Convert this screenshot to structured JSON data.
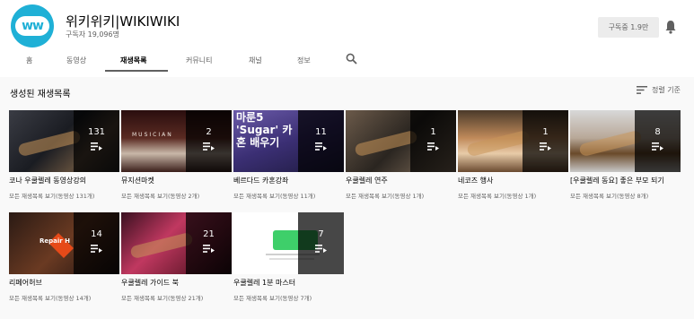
{
  "channel": {
    "name": "위키위키|WIKIWIKI",
    "subscribers": "구독자 19,096명",
    "avatar_text": "ww",
    "subscribe_label": "구독중  1.9만"
  },
  "tabs": [
    {
      "label": "홈"
    },
    {
      "label": "동영상"
    },
    {
      "label": "재생목록",
      "active": true
    },
    {
      "label": "커뮤니티"
    },
    {
      "label": "채널"
    },
    {
      "label": "정보"
    }
  ],
  "section": {
    "title": "생성된 재생목록",
    "sort_label": "정렬 기준"
  },
  "playlists": [
    {
      "title": "코나 우쿨렐레 동영상강의",
      "count": "131",
      "link": "모든 재생목록 보기(동영상 131개)"
    },
    {
      "title": "뮤지션마켓",
      "count": "2",
      "link": "모든 재생목록 보기(동영상 2개)",
      "art_text": "MUSICIAN"
    },
    {
      "title": "베르다드 카혼강좌",
      "count": "11",
      "link": "모든 재생목록 보기(동영상 11개)",
      "art_text": "마룬5 'Sugar' 카혼 배우기"
    },
    {
      "title": "우쿨렐레 연주",
      "count": "1",
      "link": "모든 재생목록 보기(동영상 1개)"
    },
    {
      "title": "네코즈 행사",
      "count": "1",
      "link": "모든 재생목록 보기(동영상 1개)"
    },
    {
      "title": "[우쿨렐레 동요] 좋은 부모 되기",
      "count": "8",
      "link": "모든 재생목록 보기(동영상 8개)"
    },
    {
      "title": "리페어허브",
      "count": "14",
      "link": "모든 재생목록 보기(동영상 14개)",
      "art_text": "Repair H"
    },
    {
      "title": "우쿨렐레 가이드 북",
      "count": "21",
      "link": "모든 재생목록 보기(동영상 21개)"
    },
    {
      "title": "우쿨렐레 1분 마스터",
      "count": "7",
      "link": "모든 재생목록 보기(동영상 7개)"
    }
  ],
  "colors": {
    "accent": "#1fb0d6",
    "text_primary": "#030303",
    "text_secondary": "#606060"
  }
}
